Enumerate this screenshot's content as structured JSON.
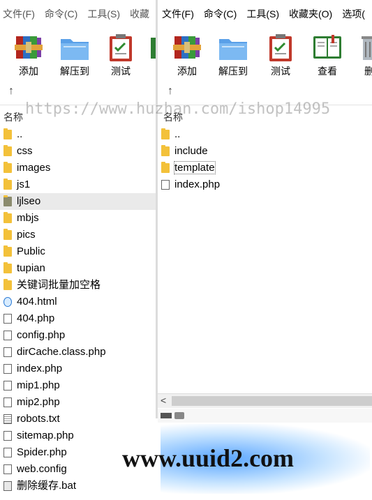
{
  "left": {
    "menu": [
      "文件(F)",
      "命令(C)",
      "工具(S)",
      "收藏"
    ],
    "toolbar": [
      "添加",
      "解压到",
      "测试"
    ],
    "header": "名称",
    "files": [
      {
        "name": "..",
        "type": "folder"
      },
      {
        "name": "css",
        "type": "folder"
      },
      {
        "name": "images",
        "type": "folder"
      },
      {
        "name": "js1",
        "type": "folder"
      },
      {
        "name": "ljlseo",
        "type": "folder-dark"
      },
      {
        "name": "mbjs",
        "type": "folder"
      },
      {
        "name": "pics",
        "type": "folder"
      },
      {
        "name": "Public",
        "type": "folder"
      },
      {
        "name": "tupian",
        "type": "folder"
      },
      {
        "name": "关键词批量加空格",
        "type": "folder"
      },
      {
        "name": "404.html",
        "type": "html"
      },
      {
        "name": "404.php",
        "type": "file"
      },
      {
        "name": "config.php",
        "type": "file"
      },
      {
        "name": "dirCache.class.php",
        "type": "file"
      },
      {
        "name": "index.php",
        "type": "file"
      },
      {
        "name": "mip1.php",
        "type": "file"
      },
      {
        "name": "mip2.php",
        "type": "file"
      },
      {
        "name": "robots.txt",
        "type": "txt"
      },
      {
        "name": "sitemap.php",
        "type": "file"
      },
      {
        "name": "Spider.php",
        "type": "file"
      },
      {
        "name": "web.config",
        "type": "file"
      },
      {
        "name": "删除缓存.bat",
        "type": "bat"
      }
    ]
  },
  "right": {
    "menu": [
      "文件(F)",
      "命令(C)",
      "工具(S)",
      "收藏夹(O)",
      "选项("
    ],
    "toolbar": [
      "添加",
      "解压到",
      "测试",
      "查看",
      "删"
    ],
    "header": "名称",
    "files": [
      {
        "name": "..",
        "type": "folder"
      },
      {
        "name": "include",
        "type": "folder"
      },
      {
        "name": "template",
        "type": "folder"
      },
      {
        "name": "index.php",
        "type": "file"
      }
    ]
  },
  "watermark": "https://www.huzhan.com/ishop14995",
  "bottom_watermark": "www.uuid2.com"
}
